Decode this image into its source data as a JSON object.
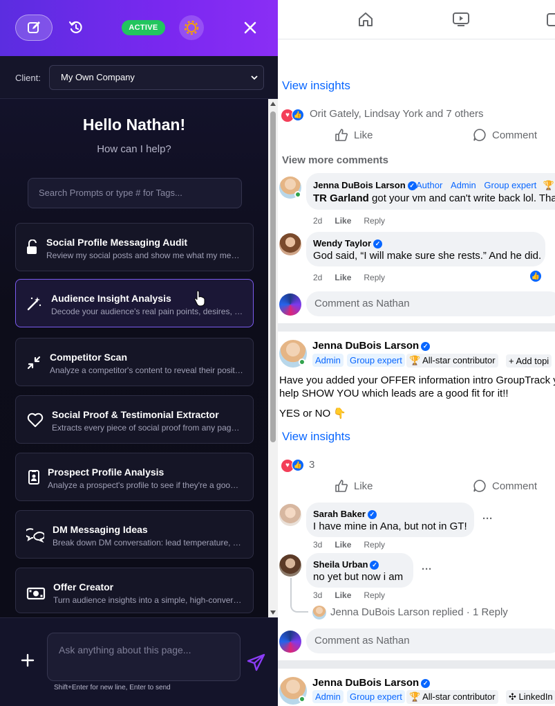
{
  "panel": {
    "status_badge": "ACTIVE",
    "client_label": "Client:",
    "client_value": "My Own Company",
    "greeting": "Hello Nathan!",
    "subgreeting": "How can I help?",
    "search_placeholder": "Search Prompts or type # for Tags...",
    "cards": [
      {
        "title": "Social Profile Messaging Audit",
        "desc": "Review my social posts and show me what my messaging is really saying",
        "icon": "unlock-icon"
      },
      {
        "title": "Audience Insight Analysis",
        "desc": "Decode your audience's real pain points, desires, objections",
        "icon": "magic-wand-icon"
      },
      {
        "title": "Competitor Scan",
        "desc": "Analyze a competitor's content to reveal their positioning",
        "icon": "compress-arrows-icon"
      },
      {
        "title": "Social Proof & Testimonial Extractor",
        "desc": "Extracts every piece of social proof from any page you are viewing",
        "icon": "heart-icon"
      },
      {
        "title": "Prospect Profile Analysis",
        "desc": "Analyze a prospect's profile to see if they're a good fit",
        "icon": "id-badge-icon"
      },
      {
        "title": "DM Messaging Ideas",
        "desc": "Break down DM conversation: lead temperature, buying signals",
        "icon": "chat-bubbles-icon"
      },
      {
        "title": "Offer Creator",
        "desc": "Turn audience insights into a simple, high-converting offer",
        "icon": "money-bill-icon"
      }
    ],
    "ask_placeholder": "Ask anything about this page...",
    "hint": "Shift+Enter for new line, Enter to send",
    "accent": "#7a28f0",
    "active_color": "#22c55e"
  },
  "fb": {
    "view_insights_1": "View insights",
    "reactors_1": "Orit Gately, Lindsay York and 7 others",
    "like": "Like",
    "comment": "Comment",
    "view_more": "View more comments",
    "c1": {
      "name": "Jenna DuBois Larson",
      "tags": [
        "Author",
        "Admin",
        "Group expert"
      ],
      "mention": "TR Garland",
      "text": " got your vm and can't write back lol. Than",
      "age": "2d",
      "like": "Like",
      "reply": "Reply"
    },
    "c2": {
      "name": "Wendy Taylor",
      "text": "God said, “I will make sure she rests.” And he did.",
      "age": "2d",
      "like": "Like",
      "reply": "Reply"
    },
    "comment_as": "Comment as Nathan",
    "post2": {
      "author": "Jenna DuBois Larson",
      "tags": [
        "Admin",
        "Group expert"
      ],
      "allstar": "All-star contributor",
      "add_topic": "+ Add topi",
      "body1": "Have you added your OFFER information intro GroupTrack ye",
      "body2": "help SHOW YOU which leads are a good fit for it!!",
      "body3": "YES or NO 👇",
      "view_insights": "View insights",
      "reaction_count": "3"
    },
    "c3": {
      "name": "Sarah Baker",
      "text": "I have mine in Ana, but not in GT!",
      "age": "3d",
      "like": "Like",
      "reply": "Reply",
      "more": "···"
    },
    "c4": {
      "name": "Sheila Urban",
      "text": "no yet but now i am",
      "age": "3d",
      "like": "Like",
      "reply": "Reply",
      "more": "···"
    },
    "replied": "Jenna DuBois Larson replied · 1 Reply",
    "post3": {
      "author": "Jenna DuBois Larson",
      "tags": [
        "Admin",
        "Group expert"
      ],
      "allstar": "All-star contributor",
      "linkedin": "LinkedIn"
    }
  }
}
